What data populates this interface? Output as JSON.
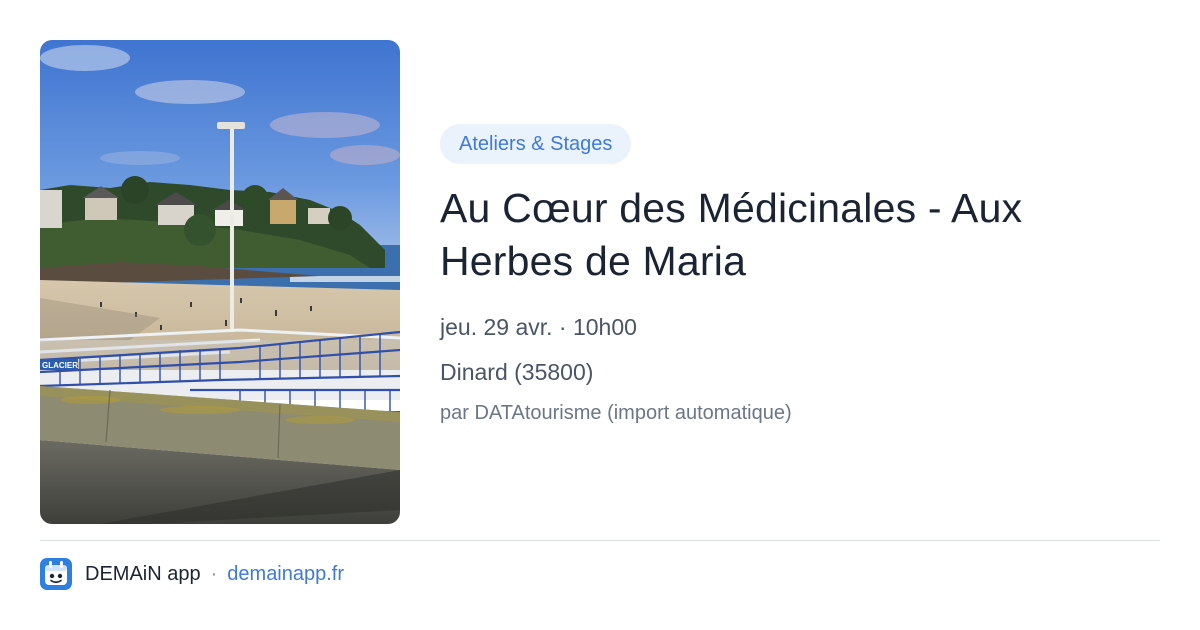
{
  "event": {
    "category_tag": "Ateliers & Stages",
    "title": "Au Cœur des Médicinales - Aux Herbes de Maria",
    "date": "jeu. 29 avr. · 10h00",
    "location": "Dinard (35800)",
    "author": "par DATAtourisme (import automatique)",
    "image_alt": "Photo de la plage de Dinard avec villas sur la pointe, lampadaire et rambarde bleue",
    "image_sign_text": "GLACIER"
  },
  "footer": {
    "app_name": "DEMAiN app",
    "separator": "·",
    "app_url": "demainapp.fr",
    "icon": "demain-app-icon"
  },
  "colors": {
    "tag_background": "#eaf2fc",
    "accent": "#3f7ad6",
    "title_text": "#1b2433",
    "meta_text": "#4a5566",
    "muted_text": "#6b7688"
  }
}
